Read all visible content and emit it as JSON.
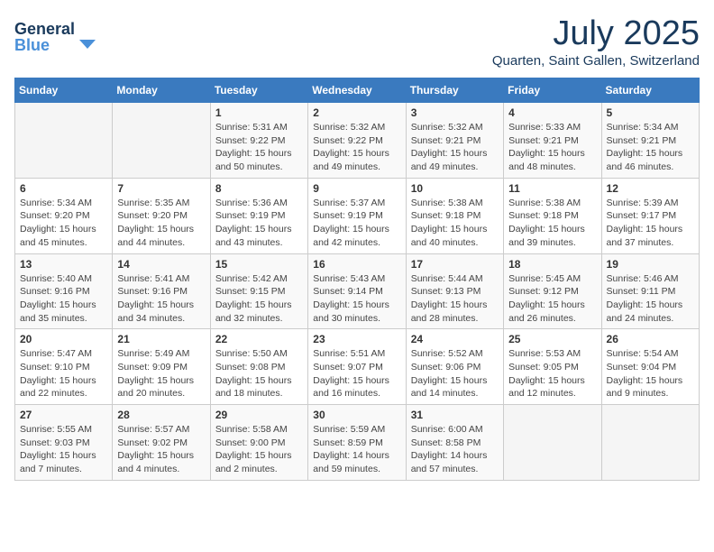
{
  "logo": {
    "general": "General",
    "blue": "Blue"
  },
  "title": "July 2025",
  "location": "Quarten, Saint Gallen, Switzerland",
  "weekdays": [
    "Sunday",
    "Monday",
    "Tuesday",
    "Wednesday",
    "Thursday",
    "Friday",
    "Saturday"
  ],
  "weeks": [
    [
      {
        "day": "",
        "info": ""
      },
      {
        "day": "",
        "info": ""
      },
      {
        "day": "1",
        "info": "Sunrise: 5:31 AM\nSunset: 9:22 PM\nDaylight: 15 hours\nand 50 minutes."
      },
      {
        "day": "2",
        "info": "Sunrise: 5:32 AM\nSunset: 9:22 PM\nDaylight: 15 hours\nand 49 minutes."
      },
      {
        "day": "3",
        "info": "Sunrise: 5:32 AM\nSunset: 9:21 PM\nDaylight: 15 hours\nand 49 minutes."
      },
      {
        "day": "4",
        "info": "Sunrise: 5:33 AM\nSunset: 9:21 PM\nDaylight: 15 hours\nand 48 minutes."
      },
      {
        "day": "5",
        "info": "Sunrise: 5:34 AM\nSunset: 9:21 PM\nDaylight: 15 hours\nand 46 minutes."
      }
    ],
    [
      {
        "day": "6",
        "info": "Sunrise: 5:34 AM\nSunset: 9:20 PM\nDaylight: 15 hours\nand 45 minutes."
      },
      {
        "day": "7",
        "info": "Sunrise: 5:35 AM\nSunset: 9:20 PM\nDaylight: 15 hours\nand 44 minutes."
      },
      {
        "day": "8",
        "info": "Sunrise: 5:36 AM\nSunset: 9:19 PM\nDaylight: 15 hours\nand 43 minutes."
      },
      {
        "day": "9",
        "info": "Sunrise: 5:37 AM\nSunset: 9:19 PM\nDaylight: 15 hours\nand 42 minutes."
      },
      {
        "day": "10",
        "info": "Sunrise: 5:38 AM\nSunset: 9:18 PM\nDaylight: 15 hours\nand 40 minutes."
      },
      {
        "day": "11",
        "info": "Sunrise: 5:38 AM\nSunset: 9:18 PM\nDaylight: 15 hours\nand 39 minutes."
      },
      {
        "day": "12",
        "info": "Sunrise: 5:39 AM\nSunset: 9:17 PM\nDaylight: 15 hours\nand 37 minutes."
      }
    ],
    [
      {
        "day": "13",
        "info": "Sunrise: 5:40 AM\nSunset: 9:16 PM\nDaylight: 15 hours\nand 35 minutes."
      },
      {
        "day": "14",
        "info": "Sunrise: 5:41 AM\nSunset: 9:16 PM\nDaylight: 15 hours\nand 34 minutes."
      },
      {
        "day": "15",
        "info": "Sunrise: 5:42 AM\nSunset: 9:15 PM\nDaylight: 15 hours\nand 32 minutes."
      },
      {
        "day": "16",
        "info": "Sunrise: 5:43 AM\nSunset: 9:14 PM\nDaylight: 15 hours\nand 30 minutes."
      },
      {
        "day": "17",
        "info": "Sunrise: 5:44 AM\nSunset: 9:13 PM\nDaylight: 15 hours\nand 28 minutes."
      },
      {
        "day": "18",
        "info": "Sunrise: 5:45 AM\nSunset: 9:12 PM\nDaylight: 15 hours\nand 26 minutes."
      },
      {
        "day": "19",
        "info": "Sunrise: 5:46 AM\nSunset: 9:11 PM\nDaylight: 15 hours\nand 24 minutes."
      }
    ],
    [
      {
        "day": "20",
        "info": "Sunrise: 5:47 AM\nSunset: 9:10 PM\nDaylight: 15 hours\nand 22 minutes."
      },
      {
        "day": "21",
        "info": "Sunrise: 5:49 AM\nSunset: 9:09 PM\nDaylight: 15 hours\nand 20 minutes."
      },
      {
        "day": "22",
        "info": "Sunrise: 5:50 AM\nSunset: 9:08 PM\nDaylight: 15 hours\nand 18 minutes."
      },
      {
        "day": "23",
        "info": "Sunrise: 5:51 AM\nSunset: 9:07 PM\nDaylight: 15 hours\nand 16 minutes."
      },
      {
        "day": "24",
        "info": "Sunrise: 5:52 AM\nSunset: 9:06 PM\nDaylight: 15 hours\nand 14 minutes."
      },
      {
        "day": "25",
        "info": "Sunrise: 5:53 AM\nSunset: 9:05 PM\nDaylight: 15 hours\nand 12 minutes."
      },
      {
        "day": "26",
        "info": "Sunrise: 5:54 AM\nSunset: 9:04 PM\nDaylight: 15 hours\nand 9 minutes."
      }
    ],
    [
      {
        "day": "27",
        "info": "Sunrise: 5:55 AM\nSunset: 9:03 PM\nDaylight: 15 hours\nand 7 minutes."
      },
      {
        "day": "28",
        "info": "Sunrise: 5:57 AM\nSunset: 9:02 PM\nDaylight: 15 hours\nand 4 minutes."
      },
      {
        "day": "29",
        "info": "Sunrise: 5:58 AM\nSunset: 9:00 PM\nDaylight: 15 hours\nand 2 minutes."
      },
      {
        "day": "30",
        "info": "Sunrise: 5:59 AM\nSunset: 8:59 PM\nDaylight: 14 hours\nand 59 minutes."
      },
      {
        "day": "31",
        "info": "Sunrise: 6:00 AM\nSunset: 8:58 PM\nDaylight: 14 hours\nand 57 minutes."
      },
      {
        "day": "",
        "info": ""
      },
      {
        "day": "",
        "info": ""
      }
    ]
  ]
}
